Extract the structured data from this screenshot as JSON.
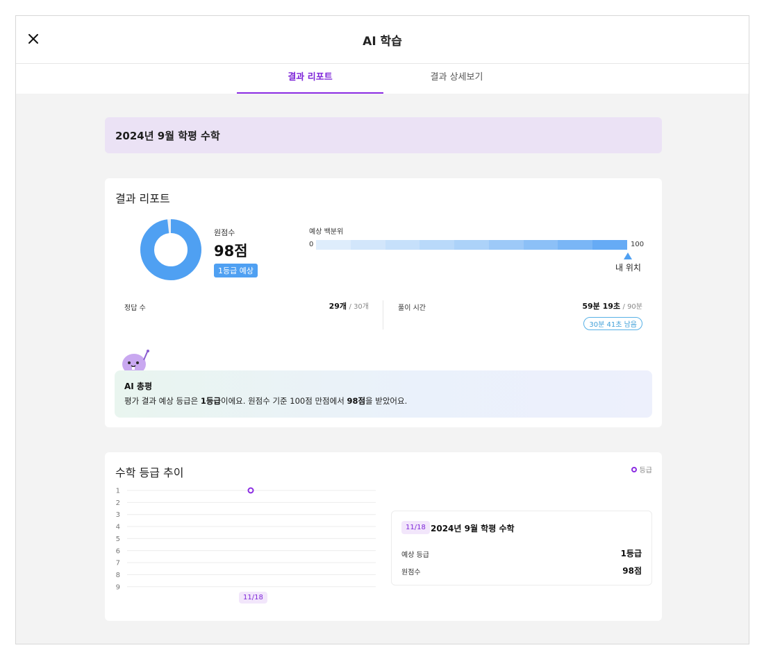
{
  "app": {
    "title": "AI 학습"
  },
  "tabs": [
    {
      "label": "결과 리포트",
      "active": true
    },
    {
      "label": "결과 상세보기",
      "active": false
    }
  ],
  "exam": {
    "name": "2024년 9월 학평 수학"
  },
  "report": {
    "title": "결과 리포트",
    "score_label": "원점수",
    "score_value": "98점",
    "score_fraction": 0.98,
    "grade_badge": "1등급 예상",
    "percentile": {
      "label": "예상 백분위",
      "min": "0",
      "max": "100",
      "my_position_label": "내 위치",
      "my_position_value": 100
    },
    "correct": {
      "label": "정답 수",
      "value": "29개",
      "total": "/ 30개"
    },
    "time": {
      "label": "풀이 시간",
      "value": "59분 19초",
      "total": "/ 90분",
      "remaining": "30분 41초 남음"
    },
    "ai_summary": {
      "title": "AI 총평",
      "text_parts": [
        "평가 결과 예상 등급은 ",
        "1등급",
        "이에요. 원점수 기준 100점 만점에서 ",
        "98점",
        "을 받았어요."
      ]
    }
  },
  "trend": {
    "title": "수학 등급 추이",
    "legend": "등급",
    "detail": {
      "date": "11/18",
      "exam": "2024년 9월 학평 수학",
      "grade_label": "예상 등급",
      "grade_value": "1등급",
      "score_label": "원점수",
      "score_value": "98점"
    }
  },
  "chart_data": {
    "type": "line",
    "x": [
      "11/18"
    ],
    "series": [
      {
        "name": "등급",
        "values": [
          1
        ]
      }
    ],
    "yticks": [
      "1",
      "2",
      "3",
      "4",
      "5",
      "6",
      "7",
      "8",
      "9"
    ],
    "ylim": [
      1,
      9
    ],
    "y_inverted": true,
    "grid": true,
    "legend": "top-right"
  },
  "colors": {
    "accent": "#8a2be2",
    "blue": "#4fa0f2",
    "banner": "#ebe2f5"
  },
  "icons": {
    "close": "close-icon",
    "mascot": "mascot-icon"
  }
}
